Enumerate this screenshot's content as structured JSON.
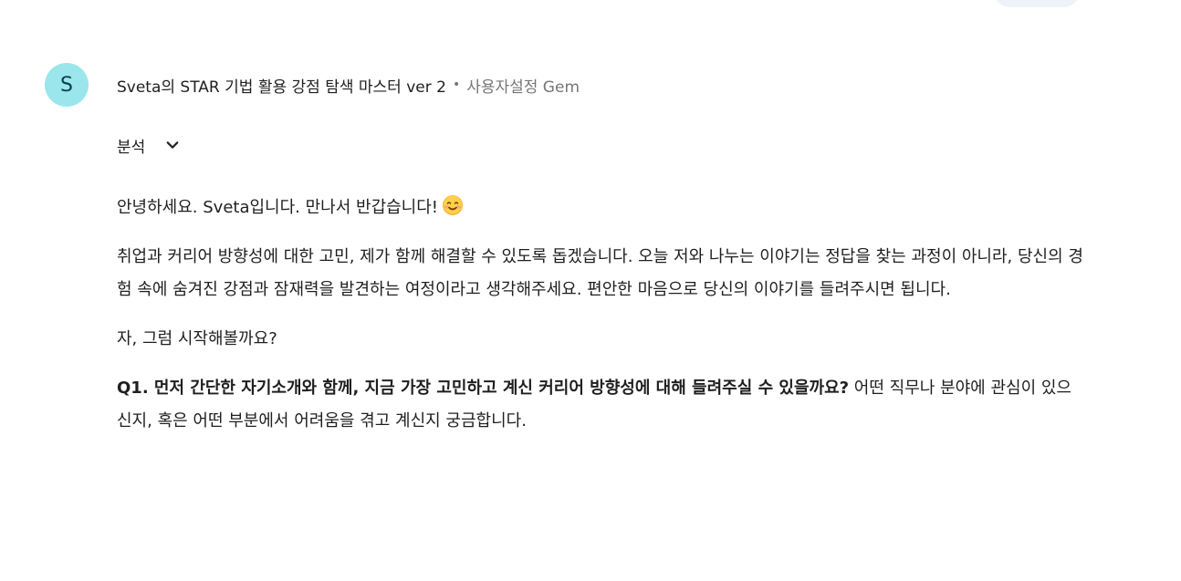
{
  "chat": {
    "avatar_letter": "S",
    "gem_name": "Sveta의 STAR 기법 활용 강점 탐색 마스터 ver 2",
    "separator": "•",
    "gem_type": "사용자설정 Gem",
    "analysis_label": "분석",
    "greeting": "안녕하세요. Sveta입니다. 만나서 반갑습니다!",
    "paragraph1": "취업과 커리어 방향성에 대한 고민, 제가 함께 해결할 수 있도록 돕겠습니다. 오늘 저와 나누는 이야기는 정답을 찾는 과정이 아니라, 당신의 경험 속에 숨겨진 강점과 잠재력을 발견하는 여정이라고 생각해주세요. 편안한 마음으로 당신의 이야기를 들려주시면 됩니다.",
    "paragraph2": "자, 그럼 시작해볼까요?",
    "question_bold": "Q1. 먼저 간단한 자기소개와 함께, 지금 가장 고민하고 계신 커리어 방향성에 대해 들려주실 수 있을까요?",
    "question_rest": " 어떤 직무나 분야에 관심이 있으신지, 혹은 어떤 부분에서 어려움을 겪고 계신지 궁금합니다."
  },
  "colors": {
    "avatar_bg": "#9ae6ec",
    "secondary_text": "#747775",
    "user_bubble": "#eef2f9"
  },
  "icons": {
    "analysis_toggle": "chevron-down-icon",
    "greeting_emoji": "smiling-face-emoji"
  }
}
